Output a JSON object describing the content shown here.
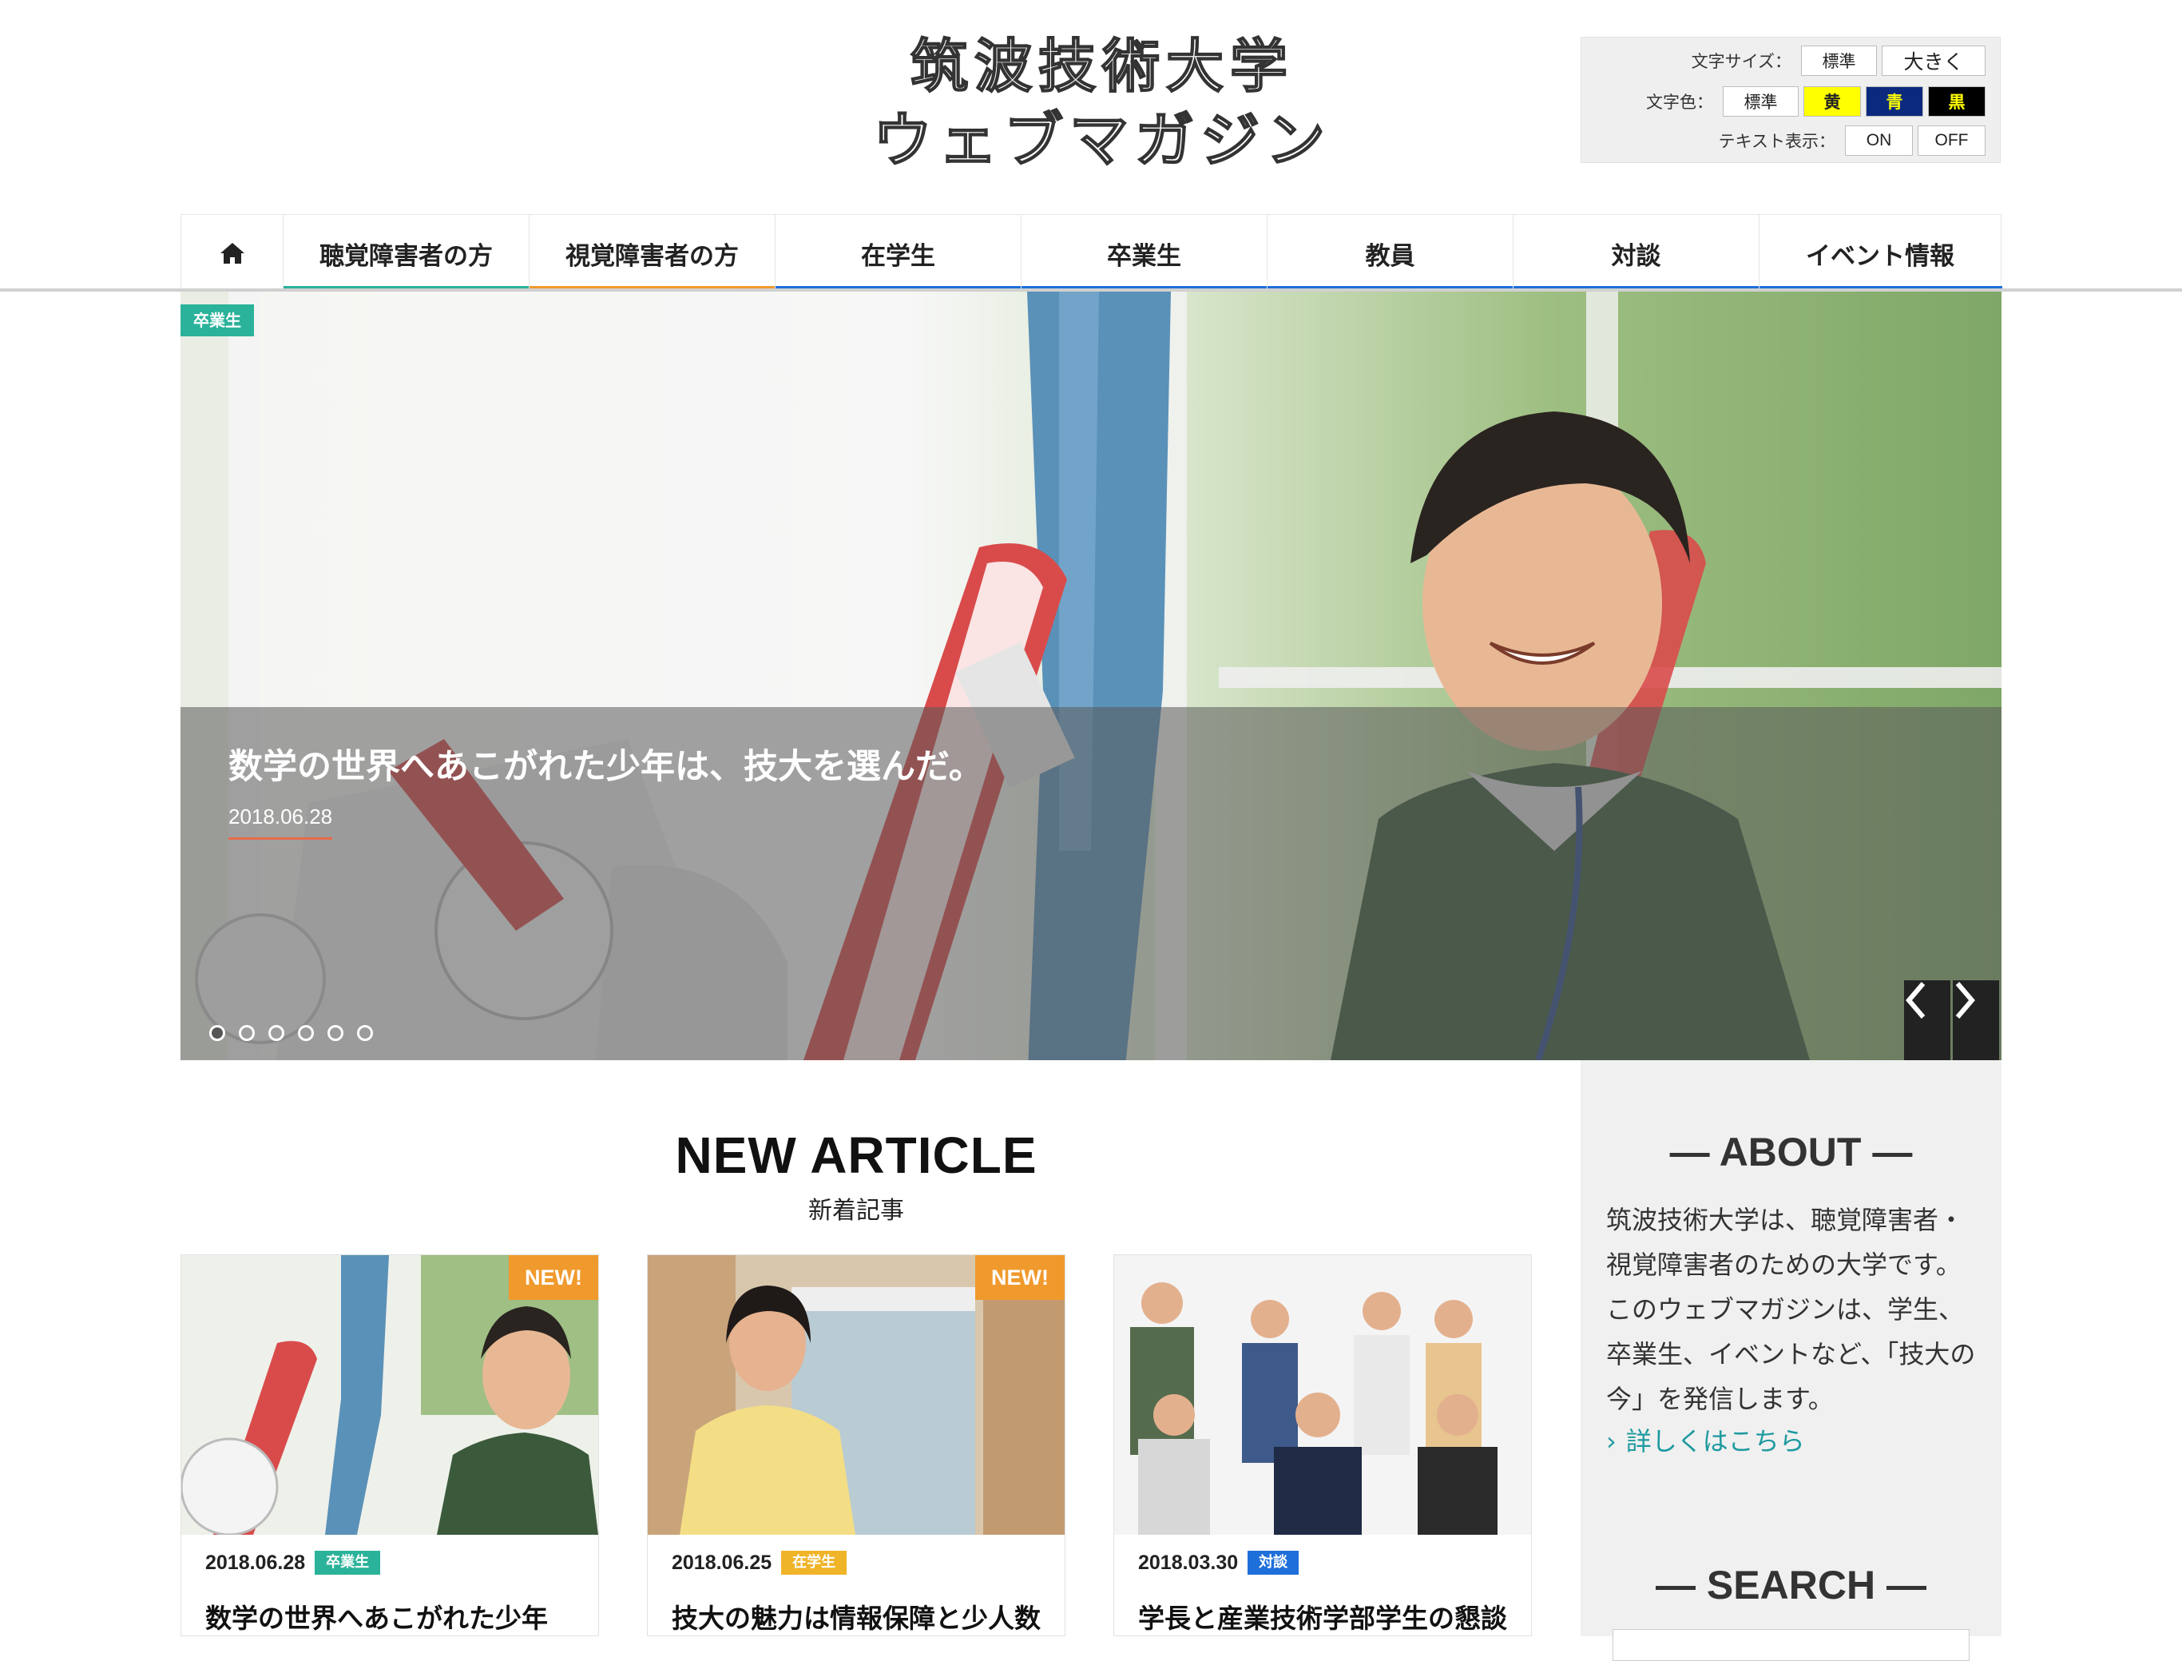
{
  "header": {
    "title_line1": "筑波技術大学",
    "title_line2": "ウェブマガジン"
  },
  "accessibility": {
    "font_size_label": "文字サイズ：",
    "font_size_options": [
      "標準",
      "大きく"
    ],
    "text_color_label": "文字色：",
    "text_color_options": [
      "標準",
      "黄",
      "青",
      "黒"
    ],
    "text_display_label": "テキスト表示：",
    "text_display_options": [
      "ON",
      "OFF"
    ]
  },
  "nav": {
    "home_icon": "home-icon",
    "items": [
      {
        "label": "聴覚障害者の方",
        "color": "#2bb29a"
      },
      {
        "label": "視覚障害者の方",
        "color": "#f09a2d"
      },
      {
        "label": "在学生",
        "color": "#1e6fd9"
      },
      {
        "label": "卒業生",
        "color": "#1e6fd9"
      },
      {
        "label": "教員",
        "color": "#1e6fd9"
      },
      {
        "label": "対談",
        "color": "#1e6fd9"
      },
      {
        "label": "イベント情報",
        "color": "#1e6fd9"
      }
    ]
  },
  "hero": {
    "tag": "卒業生",
    "title": "数学の世界へあこがれた少年は、技大を選んだ。",
    "date": "2018.06.28",
    "slide_count": 6,
    "active_slide": 1
  },
  "new_articles": {
    "heading_en": "NEW ARTICLE",
    "heading_jp": "新着記事",
    "new_badge": "NEW!",
    "cards": [
      {
        "date": "2018.06.28",
        "tag": "卒業生",
        "tag_color": "#2bb29a",
        "title": "数学の世界へあこがれた少年",
        "is_new": true
      },
      {
        "date": "2018.06.25",
        "tag": "在学生",
        "tag_color": "#f0b429",
        "title": "技大の魅力は情報保障と少人数",
        "is_new": true
      },
      {
        "date": "2018.03.30",
        "tag": "対談",
        "tag_color": "#1e6fd9",
        "title": "学長と産業技術学部学生の懇談",
        "is_new": false
      }
    ]
  },
  "sidebar": {
    "about_heading": "— ABOUT —",
    "about_text": "筑波技術大学は、聴覚障害者・視覚障害者のための大学です。このウェブマガジンは、学生、卒業生、イベントなど、「技大の今」を発信します。",
    "about_link": "詳しくはこちら",
    "search_heading": "— SEARCH —"
  },
  "colors": {
    "teal": "#2bb29a",
    "orange": "#f09a2d",
    "blue": "#1e6fd9",
    "link": "#1e9a9f"
  }
}
